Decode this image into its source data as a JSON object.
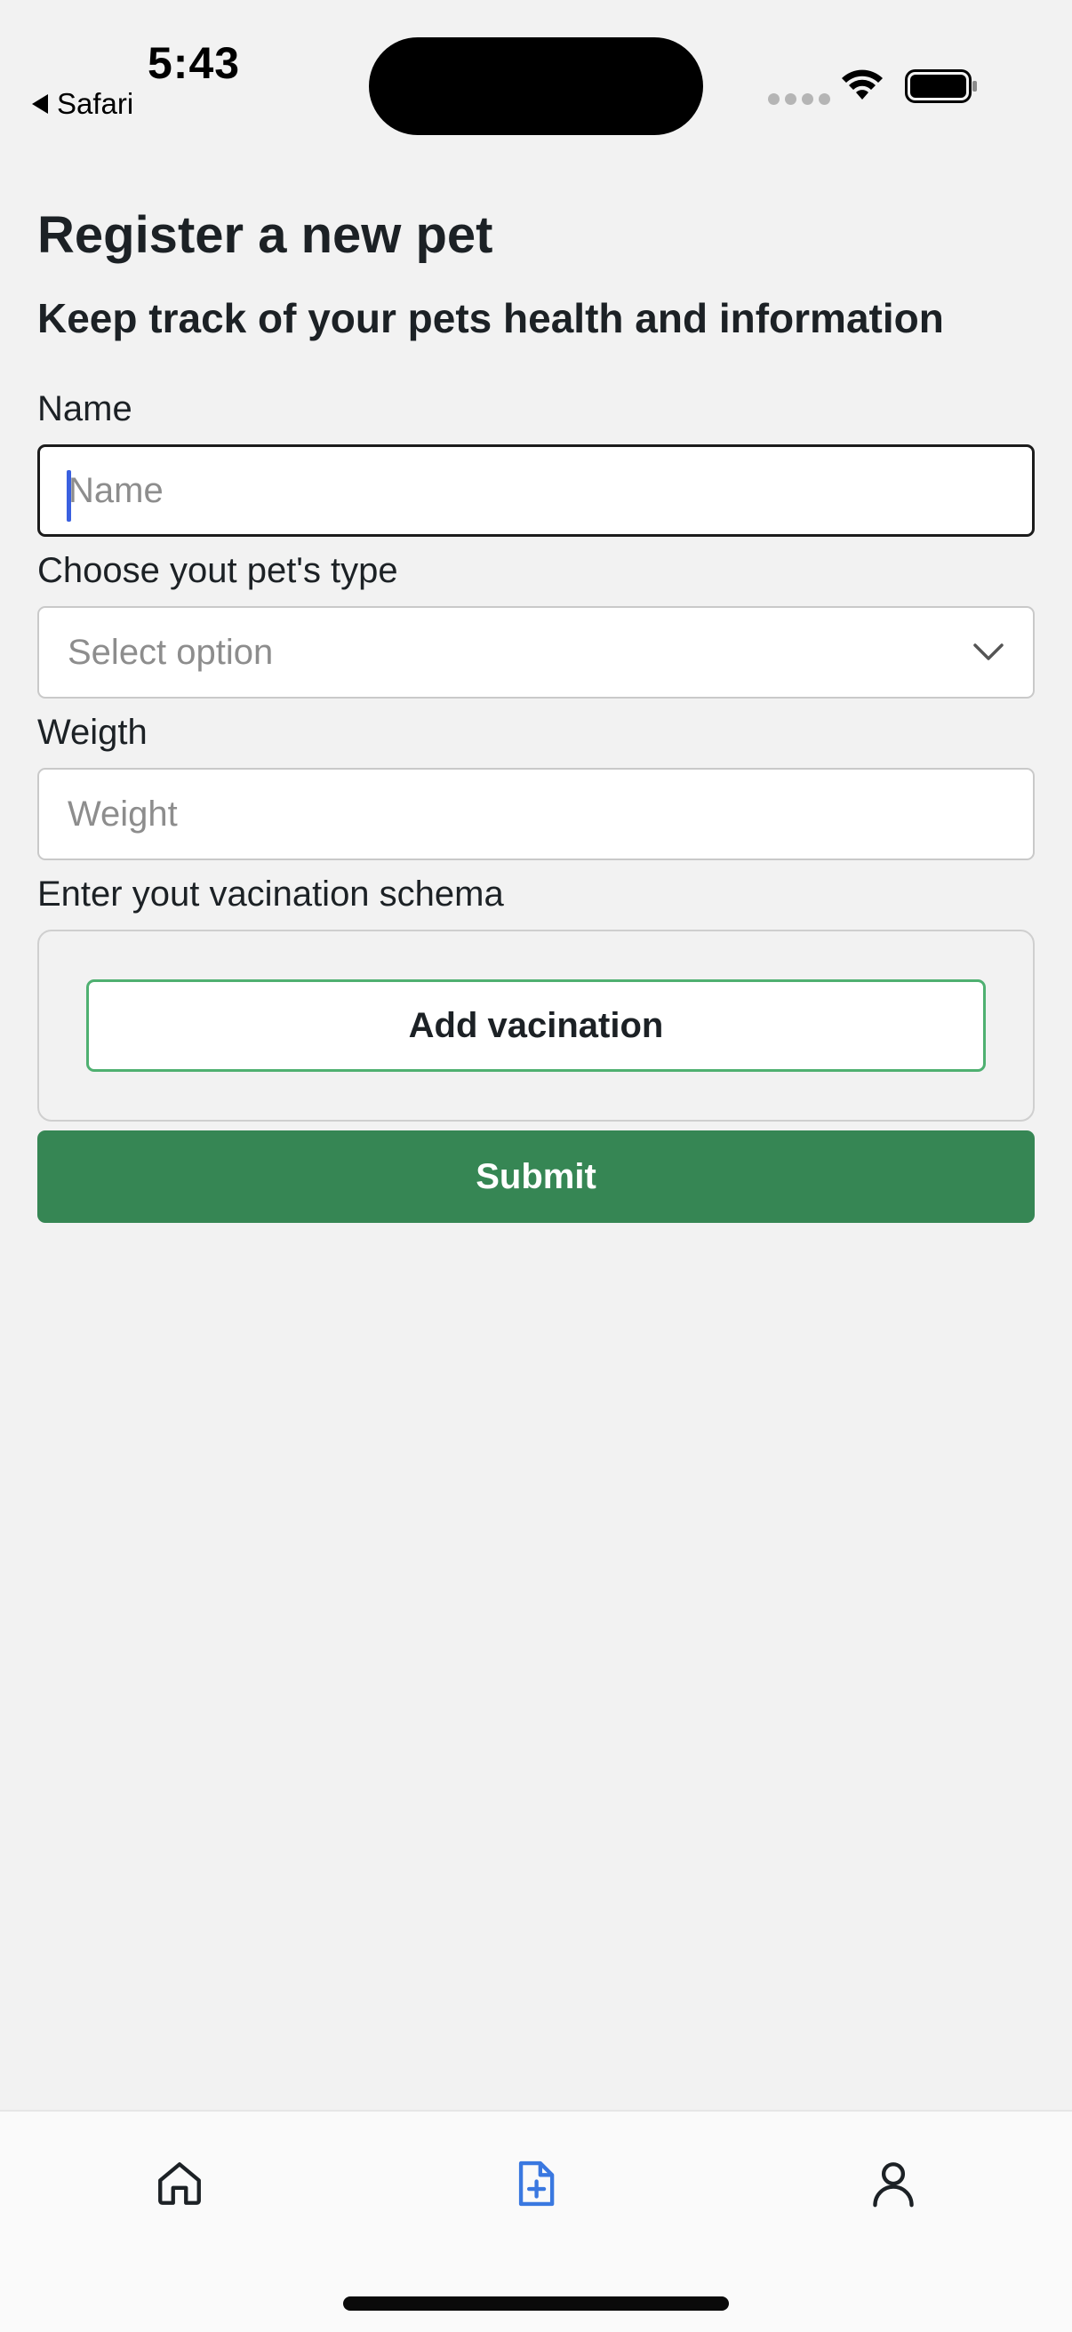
{
  "status_bar": {
    "time": "5:43",
    "back_app": "Safari",
    "icons": [
      "signal-icon",
      "wifi-icon",
      "battery-icon"
    ]
  },
  "page": {
    "title": "Register a new pet",
    "subtitle": "Keep track of your pets health and information"
  },
  "form": {
    "name": {
      "label": "Name",
      "placeholder": "Name",
      "value": ""
    },
    "pet_type": {
      "label": "Choose yout pet's type",
      "selected": "Select option"
    },
    "weight": {
      "label": "Weigth",
      "placeholder": "Weight",
      "value": ""
    },
    "vaccination": {
      "label": "Enter yout vacination schema",
      "add_button": "Add vacination"
    },
    "submit_label": "Submit"
  },
  "tab_bar": {
    "items": [
      {
        "icon": "home-icon",
        "active": false
      },
      {
        "icon": "add-document-icon",
        "active": true
      },
      {
        "icon": "user-icon",
        "active": false
      }
    ]
  },
  "colors": {
    "background": "#f2f2f2",
    "primary_green": "#368654",
    "outline_green": "#4fb071",
    "active_tab": "#3a78e0",
    "inactive_tab": "#1c2125",
    "caret": "#3a60e0"
  }
}
